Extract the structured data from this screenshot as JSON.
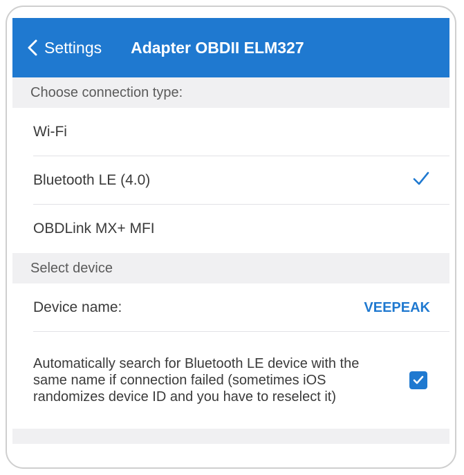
{
  "navbar": {
    "back_label": "Settings",
    "title": "Adapter OBDII ELM327"
  },
  "connection": {
    "header": "Choose connection type:",
    "options": [
      {
        "label": "Wi-Fi",
        "selected": false
      },
      {
        "label": "Bluetooth LE (4.0)",
        "selected": true
      },
      {
        "label": "OBDLink MX+ MFI",
        "selected": false
      }
    ]
  },
  "device": {
    "header": "Select device",
    "name_label": "Device name:",
    "name_value": "VEEPEAK",
    "auto_search_text": "Automatically search for Bluetooth LE device with the same name if connection failed (sometimes iOS randomizes device ID and you have to reselect it)",
    "auto_search_checked": true
  },
  "colors": {
    "accent": "#1f79d0",
    "section_bg": "#f0f0f2"
  }
}
